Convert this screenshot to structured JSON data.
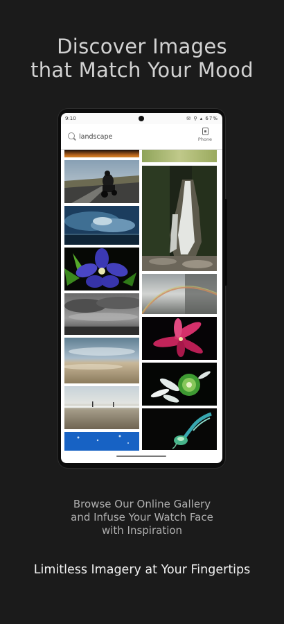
{
  "headline": {
    "line1": "Discover Images",
    "line2": "that Match Your Mood"
  },
  "status_bar": {
    "time": "9:10",
    "icons": "✉ ⚲ ▴ 67%"
  },
  "search": {
    "value": "landscape"
  },
  "phone_button": {
    "label": "Phone",
    "icon": "phone-icon"
  },
  "gallery": {
    "left_column": [
      "sunset-strip",
      "motorcyclist-on-road",
      "blue-cloudy-sky",
      "purple-flower",
      "grey-storm-clouds",
      "clouds-over-plain",
      "beach-shore",
      "blue-underwater"
    ],
    "right_column": [
      "green-grass-strip",
      "waterfall",
      "rainbow-in-mist",
      "pink-lily",
      "white-green-flower",
      "green-jellyfish"
    ]
  },
  "subtitle": {
    "line1": "Browse Our Online Gallery",
    "line2": "and Infuse Your Watch Face",
    "line3": "with Inspiration"
  },
  "tagline": "Limitless Imagery at Your Fingertips",
  "colors": {
    "background": "#1b1b1b",
    "headline": "#d2d2d2",
    "subtitle": "#b0b0b0",
    "tagline": "#f2f2f2"
  }
}
